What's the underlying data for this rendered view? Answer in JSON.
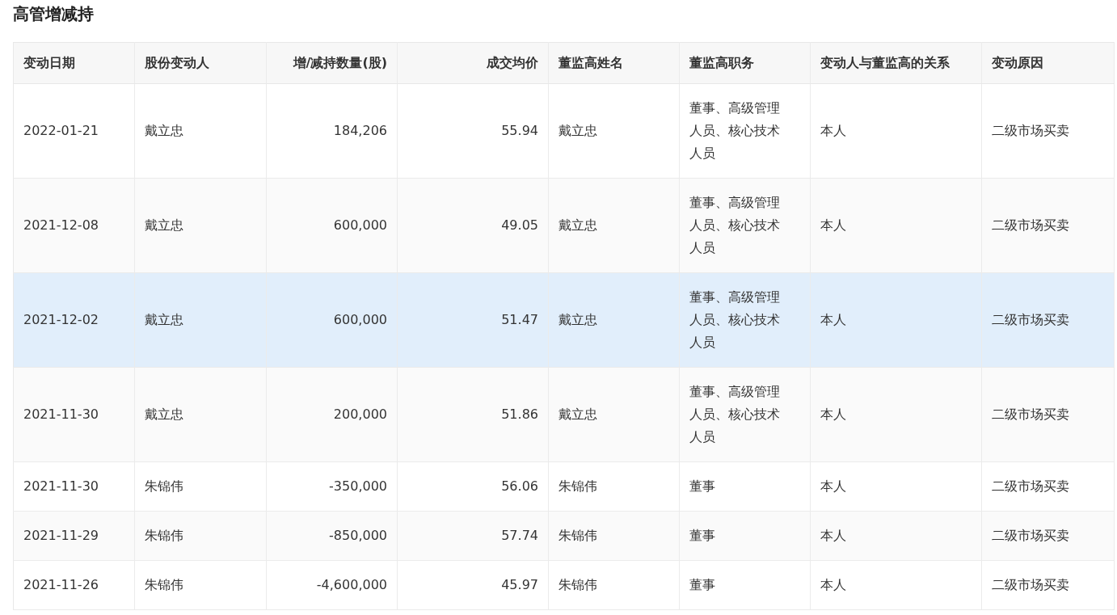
{
  "title": "高管增减持",
  "table": {
    "columns": [
      "变动日期",
      "股份变动人",
      "增/减持数量(股)",
      "成交均价",
      "董监高姓名",
      "董监高职务",
      "变动人与董监高的关系",
      "变动原因"
    ],
    "rows": [
      {
        "highlighted": false,
        "cells": [
          "2022-01-21",
          "戴立忠",
          "184,206",
          "55.94",
          "戴立忠",
          "董事、高级管理人员、核心技术人员",
          "本人",
          "二级市场买卖"
        ]
      },
      {
        "highlighted": false,
        "cells": [
          "2021-12-08",
          "戴立忠",
          "600,000",
          "49.05",
          "戴立忠",
          "董事、高级管理人员、核心技术人员",
          "本人",
          "二级市场买卖"
        ]
      },
      {
        "highlighted": true,
        "cells": [
          "2021-12-02",
          "戴立忠",
          "600,000",
          "51.47",
          "戴立忠",
          "董事、高级管理人员、核心技术人员",
          "本人",
          "二级市场买卖"
        ]
      },
      {
        "highlighted": false,
        "cells": [
          "2021-11-30",
          "戴立忠",
          "200,000",
          "51.86",
          "戴立忠",
          "董事、高级管理人员、核心技术人员",
          "本人",
          "二级市场买卖"
        ]
      },
      {
        "highlighted": false,
        "cells": [
          "2021-11-30",
          "朱锦伟",
          "-350,000",
          "56.06",
          "朱锦伟",
          "董事",
          "本人",
          "二级市场买卖"
        ]
      },
      {
        "highlighted": false,
        "cells": [
          "2021-11-29",
          "朱锦伟",
          "-850,000",
          "57.74",
          "朱锦伟",
          "董事",
          "本人",
          "二级市场买卖"
        ]
      },
      {
        "highlighted": false,
        "cells": [
          "2021-11-26",
          "朱锦伟",
          "-4,600,000",
          "45.97",
          "朱锦伟",
          "董事",
          "本人",
          "二级市场买卖"
        ]
      }
    ]
  }
}
